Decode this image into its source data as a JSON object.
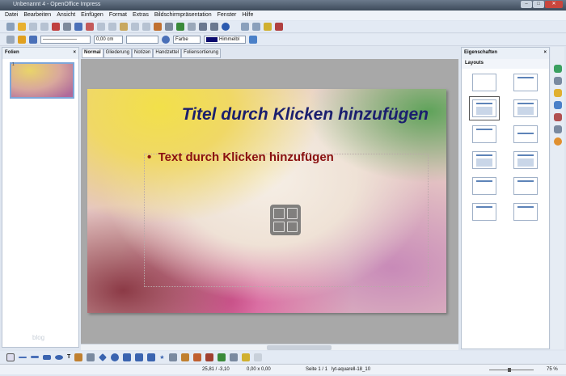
{
  "window": {
    "title": "Unbenannt 4 - OpenOffice Impress",
    "buttons": [
      "–",
      "□",
      "✕"
    ]
  },
  "menu": [
    "Datei",
    "Bearbeiten",
    "Ansicht",
    "Einfügen",
    "Format",
    "Extras",
    "Bildschirmpräsentation",
    "Fenster",
    "Hilfe"
  ],
  "toolbar2": {
    "line_width": "0,00 cm",
    "area_style": "Farbe",
    "area_color": "Himmelbl",
    "color_swatch": "#0a0a6e"
  },
  "left_panel": {
    "title": "Folien",
    "close": "×",
    "slide_number": "1"
  },
  "watermark": "blog",
  "tabs": [
    "Normal",
    "Gliederung",
    "Notizen",
    "Handzettel",
    "Foliensortierung"
  ],
  "slide": {
    "title": "Titel durch Klicken hinzufügen",
    "body": "Text durch Klicken hinzufügen",
    "bullet": "•"
  },
  "right_panel": {
    "title": "Eigenschaften",
    "close": "×",
    "section": "Layouts"
  },
  "status": {
    "position": "25,81 / -3,10",
    "size": "0,00 x 0,00",
    "page": "Seite 1 / 1",
    "design": "lyt-aquarell-18_10",
    "zoom": "75 %"
  }
}
